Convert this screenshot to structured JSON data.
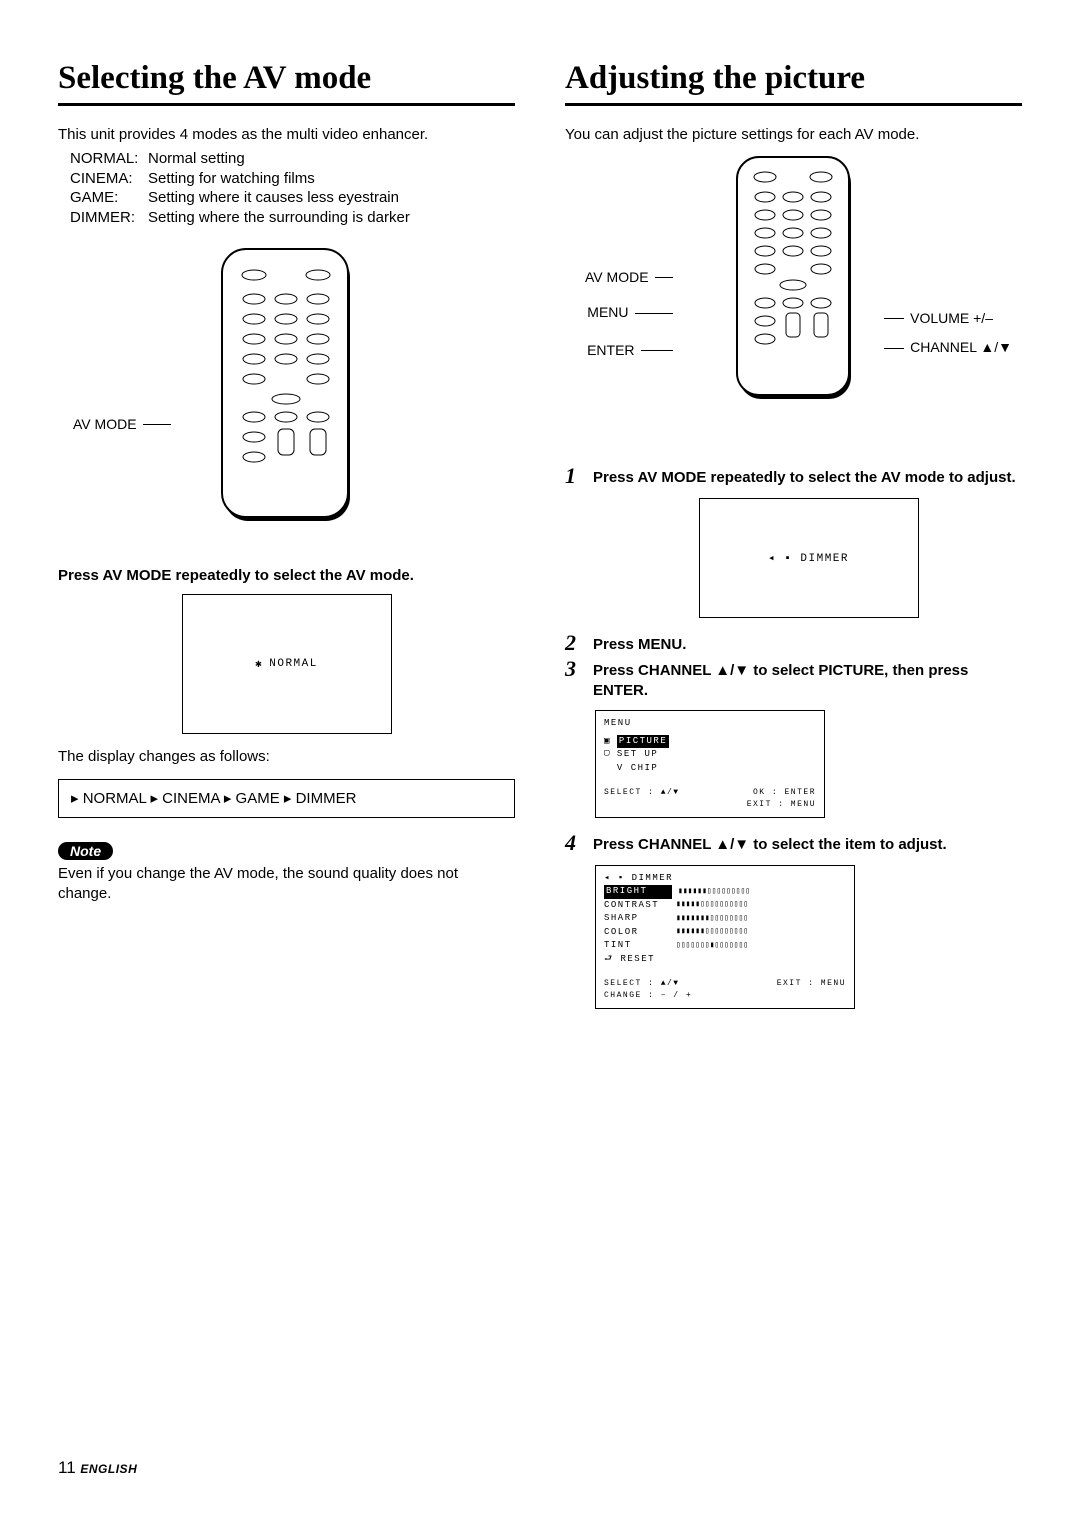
{
  "left": {
    "title": "Selecting the AV mode",
    "intro": "This unit provides 4 modes as the multi video enhancer.",
    "modes": [
      {
        "name": "NORMAL:",
        "desc": "Normal setting"
      },
      {
        "name": "CINEMA:",
        "desc": "Setting for watching films"
      },
      {
        "name": "GAME:",
        "desc": "Setting where it causes less eyestrain"
      },
      {
        "name": "DIMMER:",
        "desc": "Setting where the surrounding is darker"
      }
    ],
    "remoteLabel": "AV MODE",
    "stepHead": "Press AV MODE repeatedly to select the AV mode.",
    "osdNormal": "NORMAL",
    "caption": "The display changes as follows:",
    "cycle": "▸ NORMAL ▸ CINEMA ▸ GAME ▸ DIMMER",
    "noteLabel": "Note",
    "noteText": "Even if you change the AV mode, the sound quality does not change."
  },
  "right": {
    "title": "Adjusting the picture",
    "intro": "You can adjust the picture settings for each AV mode.",
    "remoteLabels": {
      "avMode": "AV MODE",
      "menu": "MENU",
      "enter": "ENTER",
      "volume": "VOLUME +/–",
      "channel": "CHANNEL ▲/▼"
    },
    "steps": {
      "s1": "Press AV MODE repeatedly to select the AV mode to adjust.",
      "s2": "Press MENU.",
      "s3": "Press CHANNEL ▲/▼ to select PICTURE, then press ENTER.",
      "s4": "Press CHANNEL ▲/▼ to select the item to adjust."
    },
    "osd1": "◂ ▪ DIMMER",
    "menuOsd": {
      "title": "MENU",
      "items": [
        "PICTURE",
        "SET UP",
        "V CHIP"
      ],
      "bottomLeft": "SELECT : ▲/▼",
      "bottomRight1": "OK : ENTER",
      "bottomRight2": "EXIT : MENU"
    },
    "pictureOsd": {
      "header": "◂ ▪ DIMMER",
      "items": [
        "BRIGHT",
        "CONTRAST",
        "SHARP",
        "COLOR",
        "TINT",
        "⮐ RESET"
      ],
      "bottomLeft1": "SELECT : ▲/▼",
      "bottomLeft2": "CHANGE : – / +",
      "bottomRight": "EXIT : MENU"
    }
  },
  "footer": {
    "page": "11",
    "lang": "ENGLISH"
  }
}
